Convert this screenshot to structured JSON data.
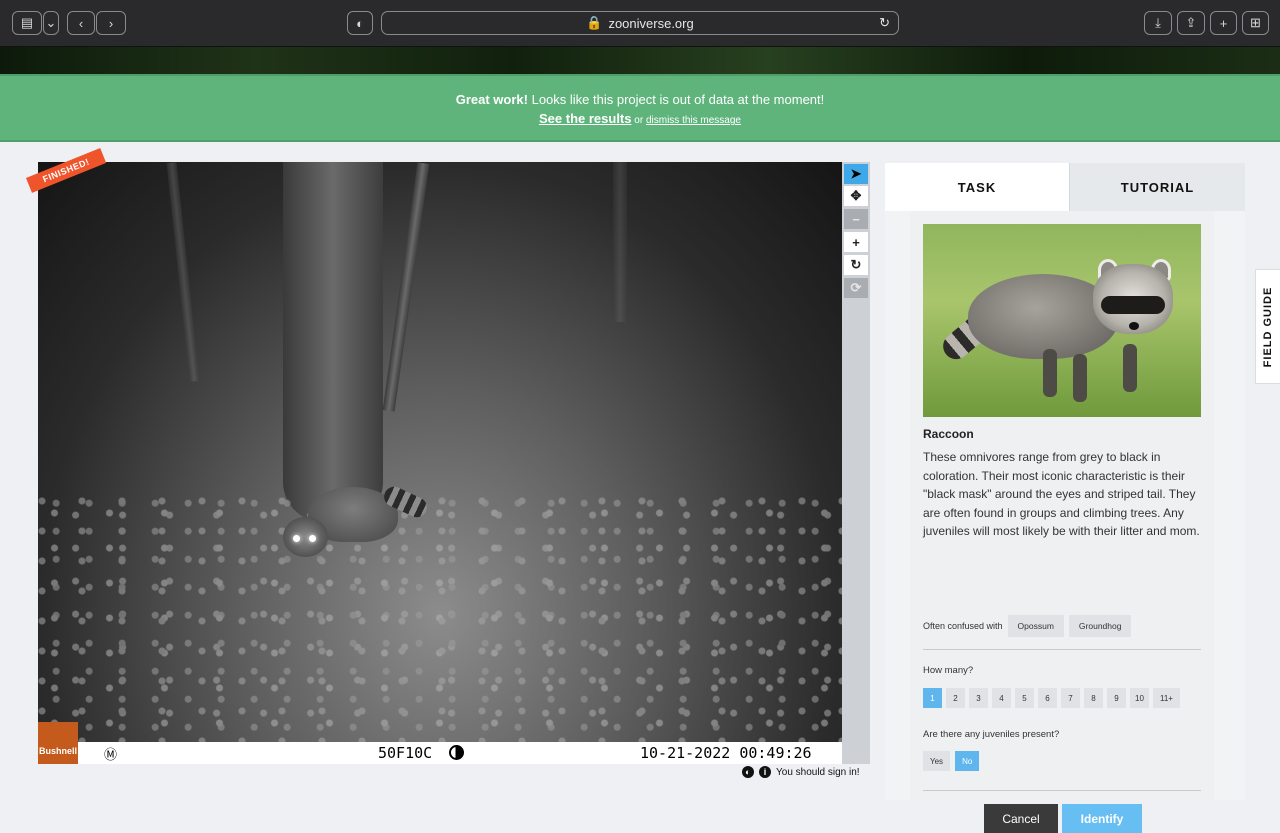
{
  "browser": {
    "url": "zooniverse.org"
  },
  "banner": {
    "bold": "Great work!",
    "message": " Looks like this project is out of data at the moment!",
    "results_link": "See the results",
    "or": " or ",
    "dismiss_link": "dismiss this message"
  },
  "subject": {
    "badge": "FINISHED!",
    "camera_brand": "Bushnell",
    "camera_mode": "Ⓜ",
    "temperature": "50F10C",
    "timestamp": "10-21-2022 00:49:26"
  },
  "toolbar": {
    "sign_in": "You should sign in!"
  },
  "panel": {
    "tabs": [
      "TASK",
      "TUTORIAL"
    ],
    "species_name": "Raccoon",
    "description": "These omnivores range from grey to black in coloration. Their most iconic characteristic is their \"black mask\" around the eyes and striped tail. They are often found in groups and climbing trees. Any juveniles will most likely be with their litter and mom.",
    "confused_label": "Often confused with",
    "confused_with": [
      "Opossum",
      "Groundhog"
    ],
    "how_many_label": "How many?",
    "how_many_options": [
      "1",
      "2",
      "3",
      "4",
      "5",
      "6",
      "7",
      "8",
      "9",
      "10",
      "11+"
    ],
    "how_many_selected": "1",
    "juveniles_label": "Are there any juveniles present?",
    "juveniles_options": [
      "Yes",
      "No"
    ],
    "juveniles_selected": "No",
    "cancel_label": "Cancel",
    "identify_label": "Identify"
  },
  "field_guide": "FIELD GUIDE",
  "colors": {
    "banner": "#5fb47c",
    "accent": "#5eb6ec",
    "badge": "#f0542b"
  }
}
